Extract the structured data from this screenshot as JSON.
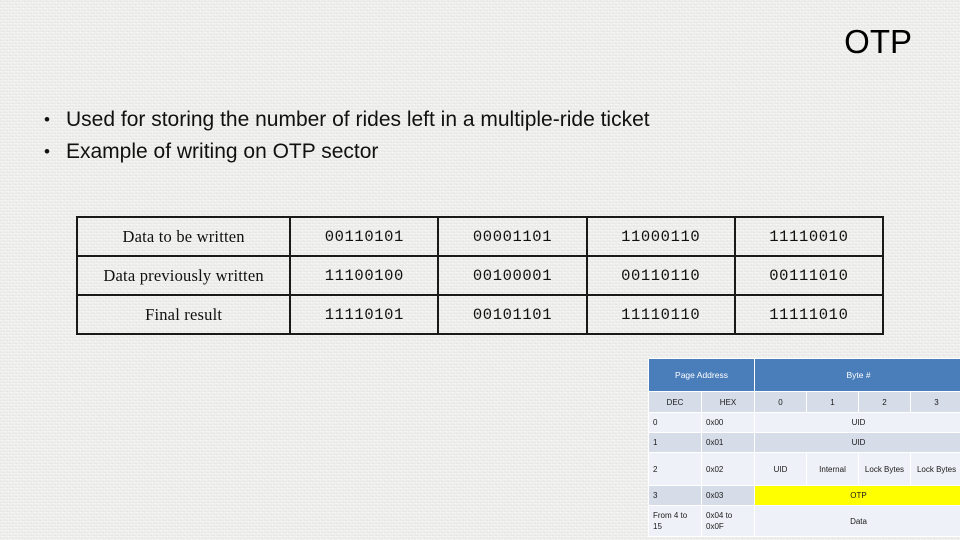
{
  "slide": {
    "title": "OTP",
    "bullet_marker": "•",
    "bullets": [
      "Used for storing the number of rides left in a multiple-ride ticket",
      "Example of writing on OTP sector"
    ]
  },
  "binary_table": {
    "rows": [
      {
        "label": "Data to be written",
        "values": [
          "00110101",
          "00001101",
          "11000110",
          "11110010"
        ]
      },
      {
        "label": "Data previously written",
        "values": [
          "11100100",
          "00100001",
          "00110110",
          "00111010"
        ]
      },
      {
        "label": "Final result",
        "values": [
          "11110101",
          "00101101",
          "11110110",
          "11111010"
        ]
      }
    ]
  },
  "memory_map": {
    "header": {
      "page_address": "Page Address",
      "byte_number": "Byte #"
    },
    "subheader": {
      "dec": "DEC",
      "hex": "HEX",
      "bytes": [
        "0",
        "1",
        "2",
        "3"
      ]
    },
    "rows": [
      {
        "dec": "0",
        "hex": "0x00",
        "span_label": "UID"
      },
      {
        "dec": "1",
        "hex": "0x01",
        "span_label": "UID"
      },
      {
        "dec": "2",
        "hex": "0x02",
        "cells": [
          "UID",
          "Internal",
          "Lock Bytes",
          "Lock Bytes"
        ]
      },
      {
        "dec": "3",
        "hex": "0x03",
        "span_label": "OTP"
      },
      {
        "dec": "From 4 to 15",
        "hex": "0x04 to 0x0F",
        "span_label": "Data"
      }
    ]
  },
  "colors": {
    "header_blue": "#4a7ebb",
    "row_light": "#eef1f7",
    "row_dark": "#d6dce8",
    "otp_highlight": "#ffff00",
    "background": "#eeeeec",
    "text": "#111111"
  }
}
